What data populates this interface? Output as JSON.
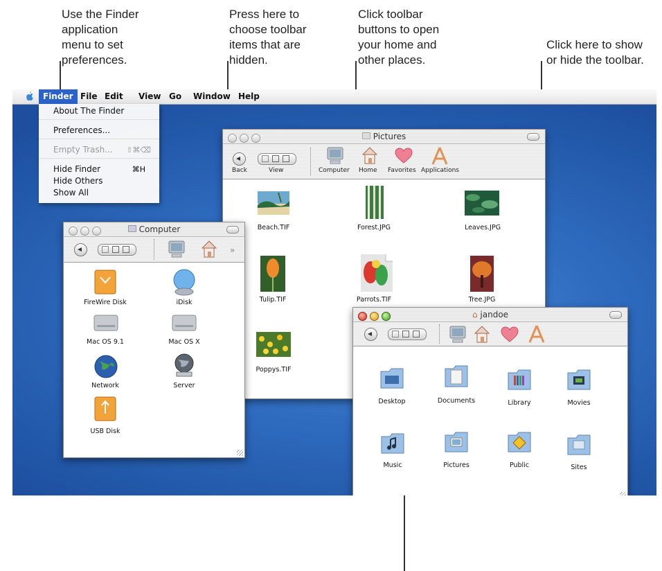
{
  "callouts": {
    "finder_menu": "Use the Finder application menu to set preferences.",
    "toolbar_hidden": "Press here to choose toolbar items that are hidden.",
    "toolbar_buttons": "Click toolbar buttons to open your home and other places.",
    "show_hide_toolbar": "Click here to show or hide the toolbar.",
    "finder_menu_lines": [
      "Use the Finder",
      "application",
      "menu to set",
      "preferences."
    ],
    "toolbar_hidden_lines": [
      "Press here to",
      "choose toolbar",
      "items that are",
      "hidden."
    ],
    "toolbar_buttons_lines": [
      "Click toolbar",
      "buttons to open",
      "your home and",
      "other places."
    ],
    "show_hide_toolbar_lines": [
      "Click here to show",
      "or hide the toolbar."
    ]
  },
  "menubar": {
    "items": [
      "Finder",
      "File",
      "Edit",
      "View",
      "Go",
      "Window",
      "Help"
    ],
    "active": "Finder"
  },
  "finder_menu": {
    "about": "About The Finder",
    "preferences": "Preferences...",
    "empty_trash": "Empty Trash...",
    "empty_trash_shortcut": "⇧⌘⌫",
    "hide_finder": "Hide Finder",
    "hide_finder_shortcut": "⌘H",
    "hide_others": "Hide Others",
    "show_all": "Show All"
  },
  "pictures_window": {
    "title": "Pictures",
    "toolbar": {
      "back": "Back",
      "view": "View",
      "computer": "Computer",
      "home": "Home",
      "favorites": "Favorites",
      "applications": "Applications"
    },
    "files": [
      "Beach.TIF",
      "Forest.JPG",
      "Leaves.JPG",
      "Tulip.TIF",
      "Parrots.TIF",
      "Tree.JPG",
      "Poppys.TIF"
    ]
  },
  "computer_window": {
    "title": "Computer",
    "items": [
      "FireWire Disk",
      "iDisk",
      "Mac OS 9.1",
      "Mac OS X",
      "Network",
      "Server",
      "USB Disk"
    ]
  },
  "home_window": {
    "title": "jandoe",
    "folders": [
      "Desktop",
      "Documents",
      "Library",
      "Movies",
      "Music",
      "Pictures",
      "Public",
      "Sites"
    ]
  },
  "dock": {
    "items": [
      "finder-icon",
      "mail-icon",
      "internet-explorer-icon",
      "sherlock-icon",
      "system-preferences-icon",
      "quicktime-icon",
      "address-icon",
      "news-icon",
      "trash-icon"
    ]
  },
  "colors": {
    "desktop": "#2f6cc0",
    "menu_highlight": "#2a62c9"
  }
}
